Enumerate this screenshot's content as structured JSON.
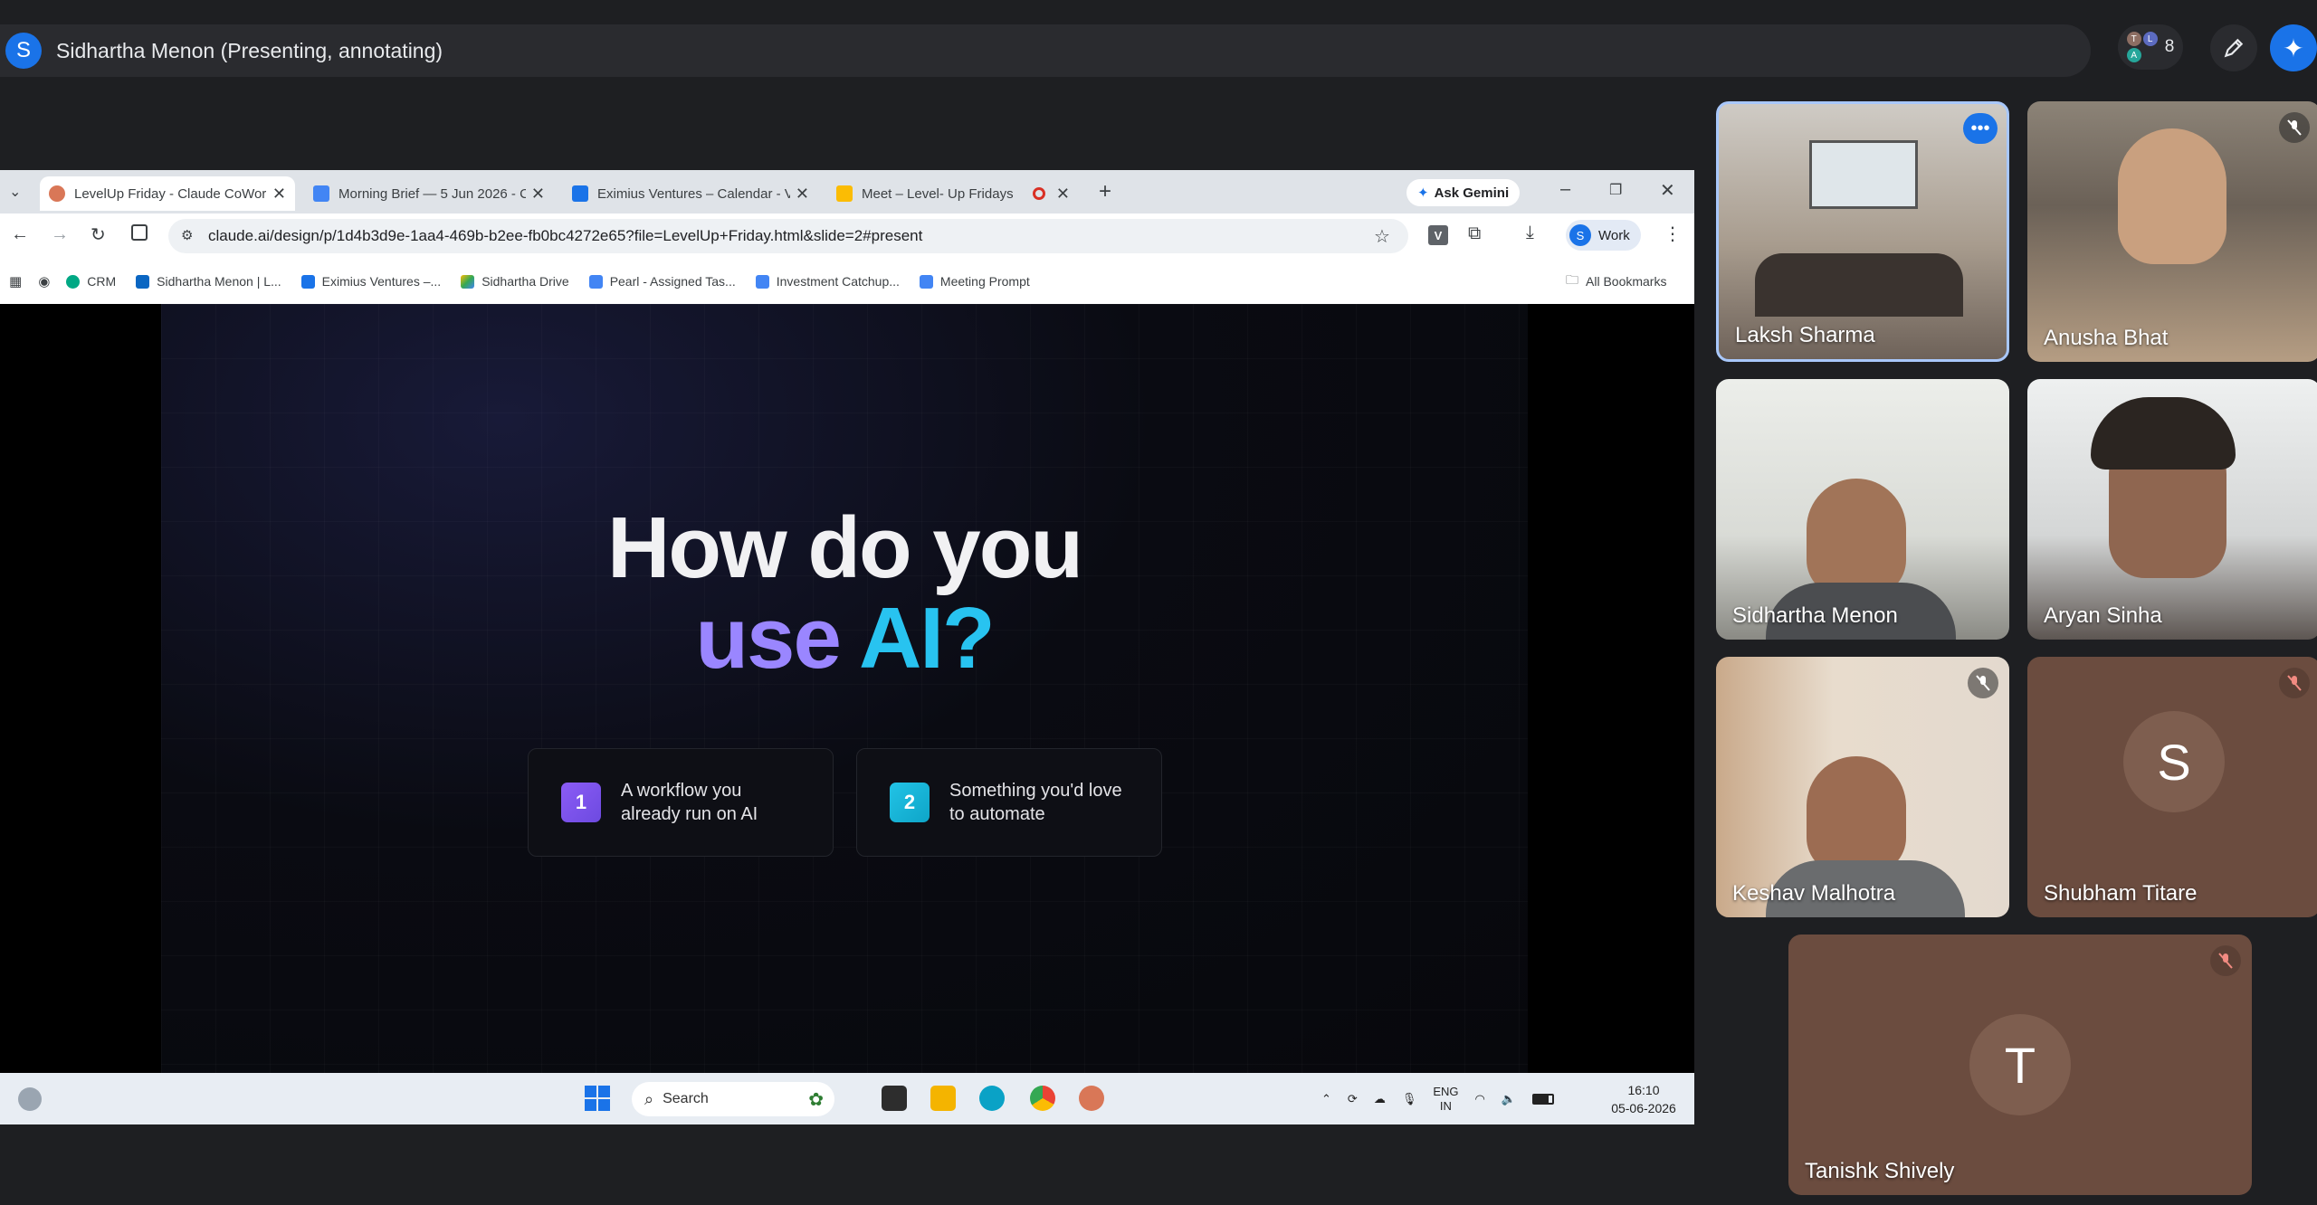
{
  "presenter": {
    "initial": "S",
    "label": "Sidhartha Menon (Presenting, annotating)"
  },
  "people": {
    "count": "8",
    "avatars": [
      "T",
      "L",
      "A"
    ]
  },
  "browser": {
    "tabs": [
      {
        "title": "LevelUp Friday - Claude CoWor",
        "active": true
      },
      {
        "title": "Morning Brief — 5 Jun 2026 - C",
        "active": false
      },
      {
        "title": "Eximius Ventures – Calendar - V",
        "active": false
      },
      {
        "title": "Meet – Level- Up Fridays",
        "active": false
      }
    ],
    "new_tab": "+",
    "ask_gemini": "Ask Gemini",
    "url": "claude.ai/design/p/1d4b3d9e-1aa4-469b-b2ee-fb0bc4272e65?file=LevelUp+Friday.html&slide=2#present",
    "profile_initial": "S",
    "profile_label": "Work",
    "ext_letter": "V",
    "bookmarks": [
      "CRM",
      "Sidhartha Menon | L...",
      "Eximius Ventures –...",
      "Sidhartha Drive",
      "Pearl - Assigned Tas...",
      "Investment Catchup...",
      "Meeting Prompt"
    ],
    "all_bookmarks": "All Bookmarks"
  },
  "slide": {
    "line1": "How do you",
    "line2a": "use ",
    "line2b": "AI?",
    "cards": [
      {
        "num": "1",
        "text": "A workflow you already run on AI"
      },
      {
        "num": "2",
        "text": "Something you'd love to automate"
      }
    ]
  },
  "taskbar": {
    "search_placeholder": "Search",
    "lang1": "ENG",
    "lang2": "IN",
    "time": "16:10",
    "date": "05-06-2026"
  },
  "participants": [
    {
      "name": "Laksh Sharma",
      "muted": false,
      "more": true
    },
    {
      "name": "Anusha Bhat",
      "muted": true
    },
    {
      "name": "Sidhartha Menon",
      "muted": false
    },
    {
      "name": "Aryan Sinha",
      "muted": false
    },
    {
      "name": "Keshav Malhotra",
      "muted": true
    },
    {
      "name": "Shubham Titare",
      "muted": true,
      "initial": "S"
    },
    {
      "name": "Tanishk Shively",
      "muted": true,
      "initial": "T"
    }
  ],
  "colors": {
    "accent_blue": "#1a73e8",
    "slide_purple": "#9a86ff",
    "slide_cyan": "#28c3f0",
    "avatar_tile": "#6b4c3f"
  }
}
